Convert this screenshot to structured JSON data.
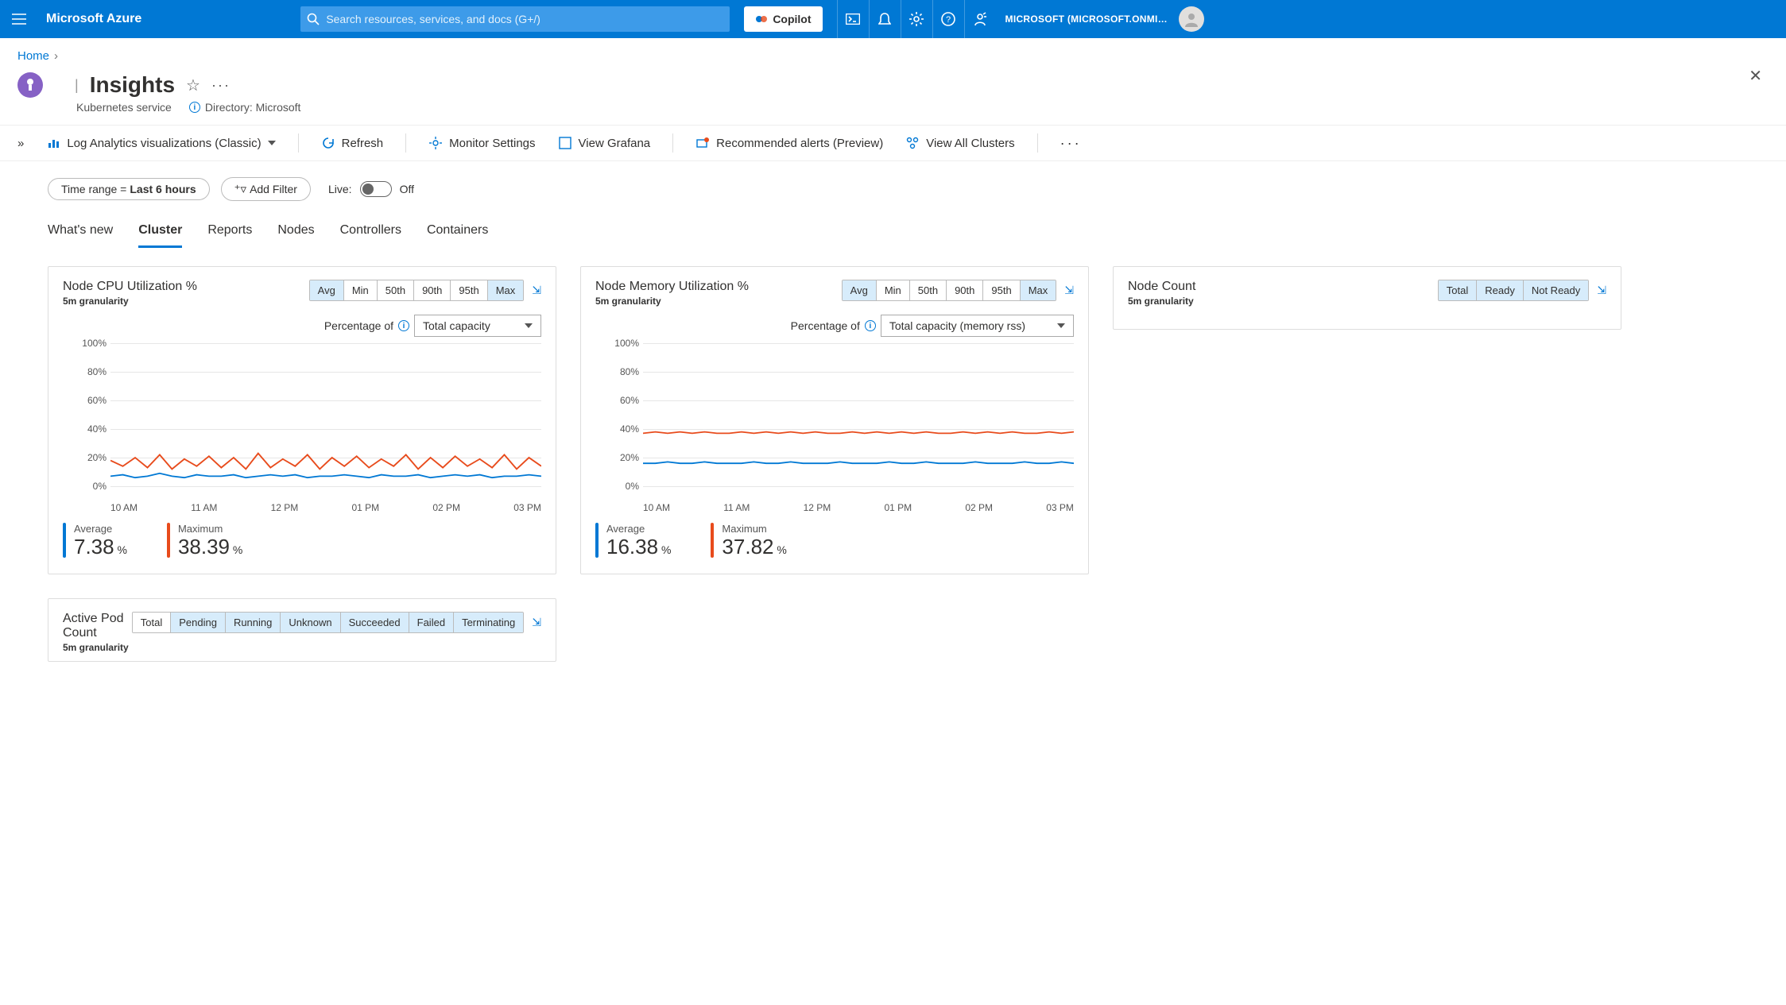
{
  "brand": "Microsoft Azure",
  "search": {
    "placeholder": "Search resources, services, and docs (G+/)"
  },
  "copilot_label": "Copilot",
  "tenant": "MICROSOFT (MICROSOFT.ONMI…",
  "breadcrumb": {
    "home": "Home"
  },
  "page": {
    "title_sep": "|",
    "title": "Insights",
    "subtitle": "Kubernetes service",
    "directory_label": "Directory: Microsoft"
  },
  "toolbar": {
    "drop_label": "Log Analytics visualizations (Classic)",
    "refresh": "Refresh",
    "monitor_settings": "Monitor Settings",
    "view_grafana": "View Grafana",
    "alerts": "Recommended alerts (Preview)",
    "view_all": "View All Clusters"
  },
  "filters": {
    "time_range_label": "Time range = ",
    "time_range_value": "Last 6 hours",
    "add_filter": "Add Filter",
    "live_label": "Live:",
    "live_off": "Off"
  },
  "tabs": [
    "What's new",
    "Cluster",
    "Reports",
    "Nodes",
    "Controllers",
    "Containers"
  ],
  "active_tab": "Cluster",
  "metric_pills": [
    "Avg",
    "Min",
    "50th",
    "90th",
    "95th",
    "Max"
  ],
  "nodecount_pills": [
    "Total",
    "Ready",
    "Not Ready"
  ],
  "pod_pills": [
    "Total",
    "Pending",
    "Running",
    "Unknown",
    "Succeeded",
    "Failed",
    "Terminating"
  ],
  "pct_of_label": "Percentage of",
  "cards": {
    "cpu": {
      "title": "Node CPU Utilization %",
      "granularity": "5m granularity",
      "ddl": "Total capacity",
      "avg_label": "Average",
      "avg_val": "7.38",
      "max_label": "Maximum",
      "max_val": "38.39"
    },
    "mem": {
      "title": "Node Memory Utilization %",
      "granularity": "5m granularity",
      "ddl": "Total capacity (memory rss)",
      "avg_label": "Average",
      "avg_val": "16.38",
      "max_label": "Maximum",
      "max_val": "37.82"
    },
    "nodecount": {
      "title": "Node Count",
      "granularity": "5m granularity"
    },
    "pod": {
      "title": "Active Pod Count",
      "granularity": "5m granularity"
    }
  },
  "chart_data": [
    {
      "type": "line",
      "title": "Node CPU Utilization %",
      "ylabel": "%",
      "ylim": [
        0,
        100
      ],
      "yticks": [
        "0%",
        "20%",
        "40%",
        "60%",
        "80%",
        "100%"
      ],
      "xticks": [
        "10 AM",
        "11 AM",
        "12 PM",
        "01 PM",
        "02 PM",
        "03 PM"
      ],
      "series": [
        {
          "name": "Average",
          "color": "#0078D4",
          "values": [
            7,
            8,
            6,
            7,
            9,
            7,
            6,
            8,
            7,
            7,
            8,
            6,
            7,
            8,
            7,
            8,
            6,
            7,
            7,
            8,
            7,
            6,
            8,
            7,
            7,
            8,
            6,
            7,
            8,
            7,
            8,
            6,
            7,
            7,
            8,
            7
          ]
        },
        {
          "name": "Maximum",
          "color": "#e84b1c",
          "values": [
            18,
            14,
            20,
            13,
            22,
            12,
            19,
            14,
            21,
            13,
            20,
            12,
            23,
            13,
            19,
            14,
            22,
            12,
            20,
            14,
            21,
            13,
            19,
            14,
            22,
            12,
            20,
            13,
            21,
            14,
            19,
            13,
            22,
            12,
            20,
            14
          ]
        }
      ]
    },
    {
      "type": "line",
      "title": "Node Memory Utilization %",
      "ylabel": "%",
      "ylim": [
        0,
        100
      ],
      "yticks": [
        "0%",
        "20%",
        "40%",
        "60%",
        "80%",
        "100%"
      ],
      "xticks": [
        "10 AM",
        "11 AM",
        "12 PM",
        "01 PM",
        "02 PM",
        "03 PM"
      ],
      "series": [
        {
          "name": "Average",
          "color": "#0078D4",
          "values": [
            16,
            16,
            17,
            16,
            16,
            17,
            16,
            16,
            16,
            17,
            16,
            16,
            17,
            16,
            16,
            16,
            17,
            16,
            16,
            16,
            17,
            16,
            16,
            17,
            16,
            16,
            16,
            17,
            16,
            16,
            16,
            17,
            16,
            16,
            17,
            16
          ]
        },
        {
          "name": "Maximum",
          "color": "#e84b1c",
          "values": [
            37,
            38,
            37,
            38,
            37,
            38,
            37,
            37,
            38,
            37,
            38,
            37,
            38,
            37,
            38,
            37,
            37,
            38,
            37,
            38,
            37,
            38,
            37,
            38,
            37,
            37,
            38,
            37,
            38,
            37,
            38,
            37,
            37,
            38,
            37,
            38
          ]
        }
      ]
    }
  ]
}
